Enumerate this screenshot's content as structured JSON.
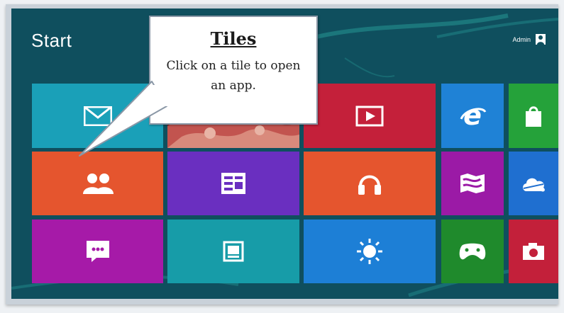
{
  "start": {
    "title": "Start"
  },
  "user": {
    "name": "Admin"
  },
  "callout": {
    "title": "Tiles",
    "body": "Click on a tile to open an app."
  },
  "tiles": [
    {
      "id": "mail",
      "label": "",
      "icon": "mail-icon",
      "color": "#1aa0b8"
    },
    {
      "id": "photos-live",
      "label": "",
      "icon": "photo-collage",
      "color": "#8b2a2a"
    },
    {
      "id": "video",
      "label": "",
      "icon": "video-icon",
      "color": "#c4203a"
    },
    {
      "id": "ie",
      "label": "",
      "icon": "internet-explorer-icon",
      "color": "#1f82d6"
    },
    {
      "id": "store",
      "label": "",
      "icon": "store-bag-icon",
      "color": "#25a23a"
    },
    {
      "id": "people",
      "label": "",
      "icon": "people-icon",
      "color": "#e5552e"
    },
    {
      "id": "calendar",
      "label": "",
      "icon": "calendar-icon",
      "color": "#6a2fc0"
    },
    {
      "id": "music",
      "label": "",
      "icon": "headphones-icon",
      "color": "#e5552e"
    },
    {
      "id": "maps",
      "label": "",
      "icon": "maps-icon",
      "color": "#9b1aa6"
    },
    {
      "id": "skydrive",
      "label": "",
      "icon": "cloud-icon",
      "color": "#1f6fd0"
    },
    {
      "id": "messaging",
      "label": "",
      "icon": "messaging-icon",
      "color": "#a61aa8"
    },
    {
      "id": "desktop",
      "label": "",
      "icon": "desktop-icon",
      "color": "#179ca8"
    },
    {
      "id": "weather",
      "label": "",
      "icon": "sun-icon",
      "color": "#1d7fd6"
    },
    {
      "id": "xbox-games",
      "label": "",
      "icon": "game-controller-icon",
      "color": "#1f8a2c"
    },
    {
      "id": "camera",
      "label": "",
      "icon": "camera-icon",
      "color": "#c3203a"
    }
  ],
  "colors": {
    "background": "#0f4f5e",
    "frame": "#c9d1d9",
    "accent_swoosh": "#2aa6a0"
  }
}
